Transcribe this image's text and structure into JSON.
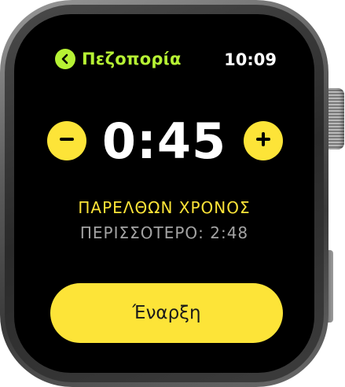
{
  "app": {
    "title": "Πεζοπορία",
    "accent_color": "#b6f234",
    "back_icon": "chevron-left-icon"
  },
  "status": {
    "time": "10:09"
  },
  "timer": {
    "value": "0:45",
    "decrement_icon": "minus-icon",
    "increment_icon": "plus-icon",
    "button_color": "#fde438"
  },
  "info": {
    "label": "ΠΑΡΕΛΘΩΝ ΧΡΟΝΟΣ",
    "remaining": "ΠΕΡΙΣΣΟΤΕΡΟ: 2:48",
    "label_color": "#fde438",
    "remaining_color": "#a3a3a3"
  },
  "actions": {
    "start_label": "Έναρξη",
    "start_color": "#fde438"
  }
}
